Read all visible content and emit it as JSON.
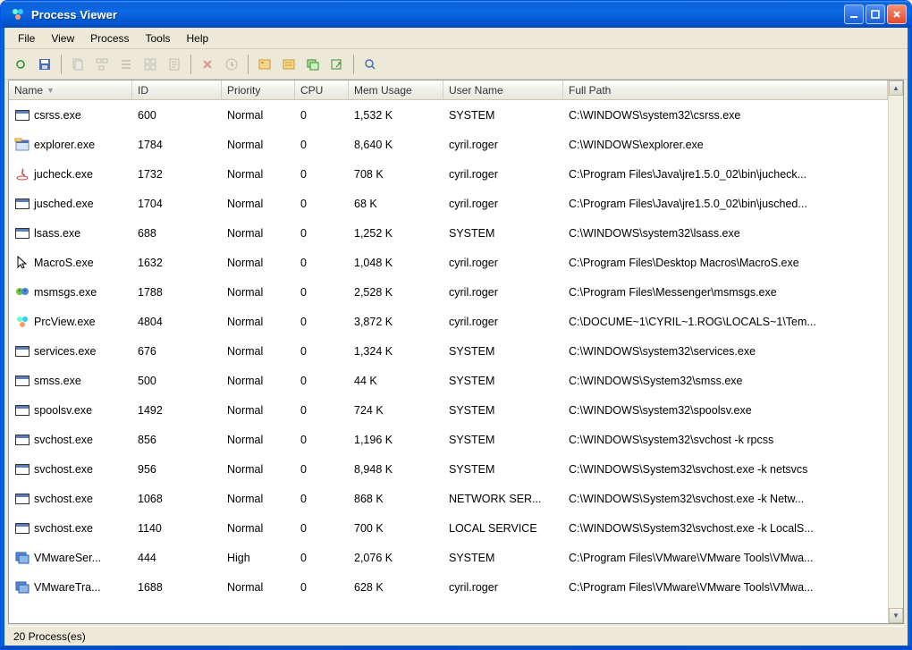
{
  "title": "Process Viewer",
  "menus": [
    "File",
    "View",
    "Process",
    "Tools",
    "Help"
  ],
  "columns": {
    "name": "Name",
    "id": "ID",
    "priority": "Priority",
    "cpu": "CPU",
    "mem": "Mem Usage",
    "user": "User Name",
    "path": "Full Path"
  },
  "status": "20 Process(es)",
  "rows": [
    {
      "icon": "win",
      "name": "csrss.exe",
      "id": "600",
      "priority": "Normal",
      "cpu": "0",
      "mem": "1,532 K",
      "user": "SYSTEM",
      "path": "C:\\WINDOWS\\system32\\csrss.exe"
    },
    {
      "icon": "explorer",
      "name": "explorer.exe",
      "id": "1784",
      "priority": "Normal",
      "cpu": "0",
      "mem": "8,640 K",
      "user": "cyril.roger",
      "path": "C:\\WINDOWS\\explorer.exe"
    },
    {
      "icon": "java",
      "name": "jucheck.exe",
      "id": "1732",
      "priority": "Normal",
      "cpu": "0",
      "mem": "708 K",
      "user": "cyril.roger",
      "path": "C:\\Program Files\\Java\\jre1.5.0_02\\bin\\jucheck..."
    },
    {
      "icon": "win",
      "name": "jusched.exe",
      "id": "1704",
      "priority": "Normal",
      "cpu": "0",
      "mem": "68 K",
      "user": "cyril.roger",
      "path": "C:\\Program Files\\Java\\jre1.5.0_02\\bin\\jusched..."
    },
    {
      "icon": "win",
      "name": "lsass.exe",
      "id": "688",
      "priority": "Normal",
      "cpu": "0",
      "mem": "1,252 K",
      "user": "SYSTEM",
      "path": "C:\\WINDOWS\\system32\\lsass.exe"
    },
    {
      "icon": "cursor",
      "name": "MacroS.exe",
      "id": "1632",
      "priority": "Normal",
      "cpu": "0",
      "mem": "1,048 K",
      "user": "cyril.roger",
      "path": "C:\\Program Files\\Desktop Macros\\MacroS.exe"
    },
    {
      "icon": "msn",
      "name": "msmsgs.exe",
      "id": "1788",
      "priority": "Normal",
      "cpu": "0",
      "mem": "2,528 K",
      "user": "cyril.roger",
      "path": "C:\\Program Files\\Messenger\\msmsgs.exe"
    },
    {
      "icon": "prcview",
      "name": "PrcView.exe",
      "id": "4804",
      "priority": "Normal",
      "cpu": "0",
      "mem": "3,872 K",
      "user": "cyril.roger",
      "path": "C:\\DOCUME~1\\CYRIL~1.ROG\\LOCALS~1\\Tem..."
    },
    {
      "icon": "win",
      "name": "services.exe",
      "id": "676",
      "priority": "Normal",
      "cpu": "0",
      "mem": "1,324 K",
      "user": "SYSTEM",
      "path": "C:\\WINDOWS\\system32\\services.exe"
    },
    {
      "icon": "win",
      "name": "smss.exe",
      "id": "500",
      "priority": "Normal",
      "cpu": "0",
      "mem": "44 K",
      "user": "SYSTEM",
      "path": "C:\\WINDOWS\\System32\\smss.exe"
    },
    {
      "icon": "win",
      "name": "spoolsv.exe",
      "id": "1492",
      "priority": "Normal",
      "cpu": "0",
      "mem": "724 K",
      "user": "SYSTEM",
      "path": "C:\\WINDOWS\\system32\\spoolsv.exe"
    },
    {
      "icon": "win",
      "name": "svchost.exe",
      "id": "856",
      "priority": "Normal",
      "cpu": "0",
      "mem": "1,196 K",
      "user": "SYSTEM",
      "path": "C:\\WINDOWS\\system32\\svchost -k rpcss"
    },
    {
      "icon": "win",
      "name": "svchost.exe",
      "id": "956",
      "priority": "Normal",
      "cpu": "0",
      "mem": "8,948 K",
      "user": "SYSTEM",
      "path": "C:\\WINDOWS\\System32\\svchost.exe -k netsvcs"
    },
    {
      "icon": "win",
      "name": "svchost.exe",
      "id": "1068",
      "priority": "Normal",
      "cpu": "0",
      "mem": "868 K",
      "user": "NETWORK SER...",
      "path": "C:\\WINDOWS\\System32\\svchost.exe -k Netw..."
    },
    {
      "icon": "win",
      "name": "svchost.exe",
      "id": "1140",
      "priority": "Normal",
      "cpu": "0",
      "mem": "700 K",
      "user": "LOCAL SERVICE",
      "path": "C:\\WINDOWS\\System32\\svchost.exe -k LocalS..."
    },
    {
      "icon": "vmware",
      "name": "VMwareSer...",
      "id": "444",
      "priority": "High",
      "cpu": "0",
      "mem": "2,076 K",
      "user": "SYSTEM",
      "path": "C:\\Program Files\\VMware\\VMware Tools\\VMwa..."
    },
    {
      "icon": "vmware",
      "name": "VMwareTra...",
      "id": "1688",
      "priority": "Normal",
      "cpu": "0",
      "mem": "628 K",
      "user": "cyril.roger",
      "path": "C:\\Program Files\\VMware\\VMware Tools\\VMwa..."
    }
  ]
}
